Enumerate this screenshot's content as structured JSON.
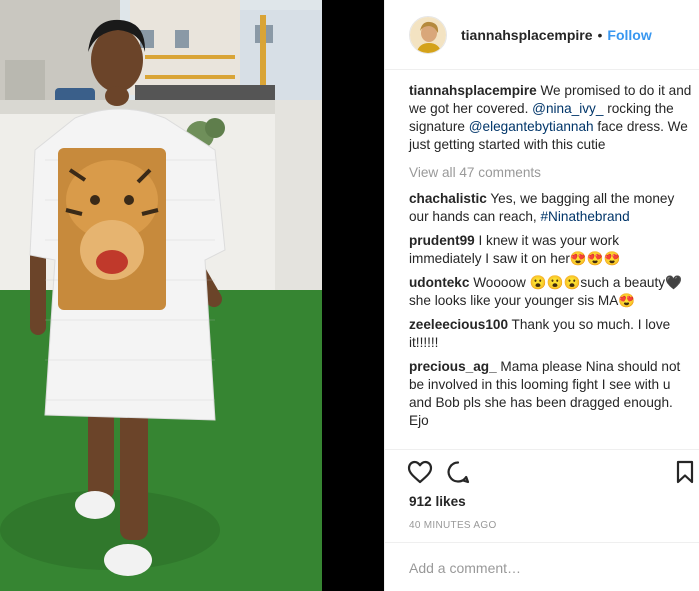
{
  "post": {
    "username": "tiannahsplacempire",
    "separator": "•",
    "follow_label": "Follow"
  },
  "caption": {
    "username": "tiannahsplacempire",
    "text_1": " We promised to do it and we got her covered. ",
    "mention_1": "@nina_ivy_",
    "text_2": " rocking the signature ",
    "mention_2": "@elegantebytiannah",
    "text_3": " face dress. We just getting started with this cutie"
  },
  "view_all_label": "View all 47 comments",
  "comments": [
    {
      "username": "chachalistic",
      "text": " Yes, we bagging all the money our hands can reach, ",
      "tag": "#Ninathebrand"
    },
    {
      "username": "prudent99",
      "text": " I knew it was your work immediately I saw it on her😍😍😍"
    },
    {
      "username": "udontekc",
      "text": " Woooow 😮😮😮such a beauty🖤 she looks like your younger sis MA😍"
    },
    {
      "username": "zeeleecious100",
      "text": " Thank you so much. I love it!!!!!!"
    },
    {
      "username": "precious_ag_",
      "text": " Mama please Nina should not be involved in this looming fight I see with u and Bob pls she has been dragged enough. Ejo"
    }
  ],
  "icons": {
    "like": "heart-icon",
    "comment": "comment-bubble-icon",
    "save": "bookmark-icon"
  },
  "likes_label": "912 likes",
  "time_label": "40 MINUTES AGO",
  "add_comment_placeholder": "Add a comment…",
  "colors": {
    "link": "#003569",
    "follow": "#3897f0",
    "muted": "#999999",
    "text": "#262626"
  }
}
